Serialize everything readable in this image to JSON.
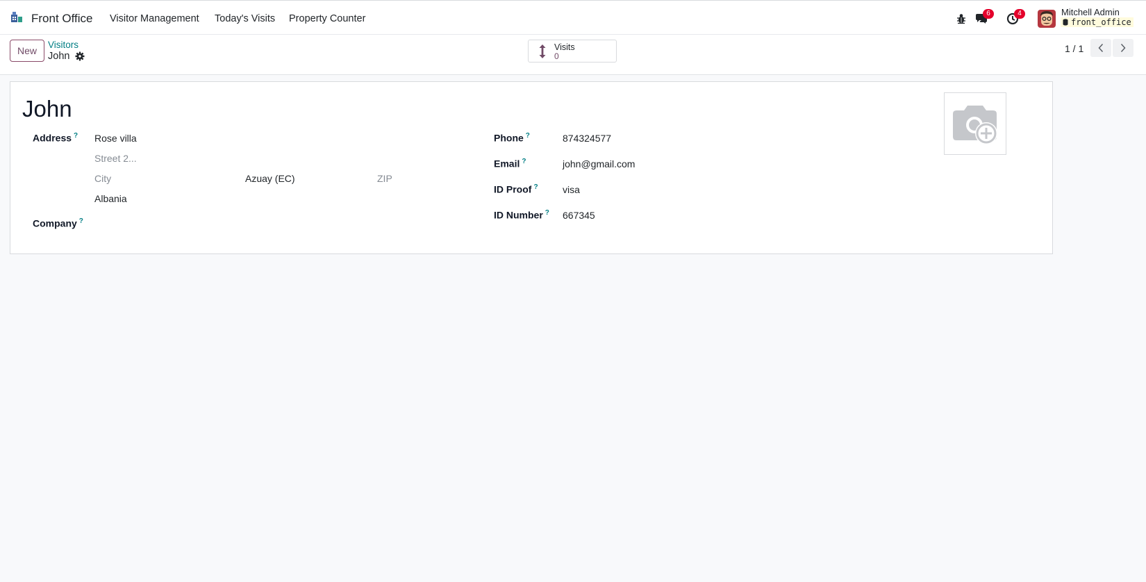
{
  "topbar": {
    "app_name": "Front Office",
    "app_icon": "front-office-app-icon",
    "menu": [
      "Visitor Management",
      "Today's Visits",
      "Property Counter"
    ],
    "messages_count": "6",
    "activities_count": "4",
    "user_name": "Mitchell Admin",
    "database": "front_office"
  },
  "control": {
    "new_label": "New",
    "breadcrumb_parent": "Visitors",
    "breadcrumb_current": "John",
    "smart_button": {
      "label": "Visits",
      "value": "0"
    },
    "pager": "1 / 1"
  },
  "form": {
    "name": "John",
    "address": {
      "label": "Address",
      "street": "Rose villa",
      "street2_placeholder": "Street 2...",
      "city_placeholder": "City",
      "state": "Azuay (EC)",
      "zip_placeholder": "ZIP",
      "country": "Albania"
    },
    "company": {
      "label": "Company",
      "value": ""
    },
    "phone": {
      "label": "Phone",
      "value": "874324577"
    },
    "email": {
      "label": "Email",
      "value": "john@gmail.com"
    },
    "id_proof": {
      "label": "ID Proof",
      "value": "visa"
    },
    "id_number": {
      "label": "ID Number",
      "value": "667345"
    },
    "help_mark": "?"
  },
  "colors": {
    "brand": "#714B67",
    "link": "#017e84",
    "badge": "#e4002b"
  }
}
